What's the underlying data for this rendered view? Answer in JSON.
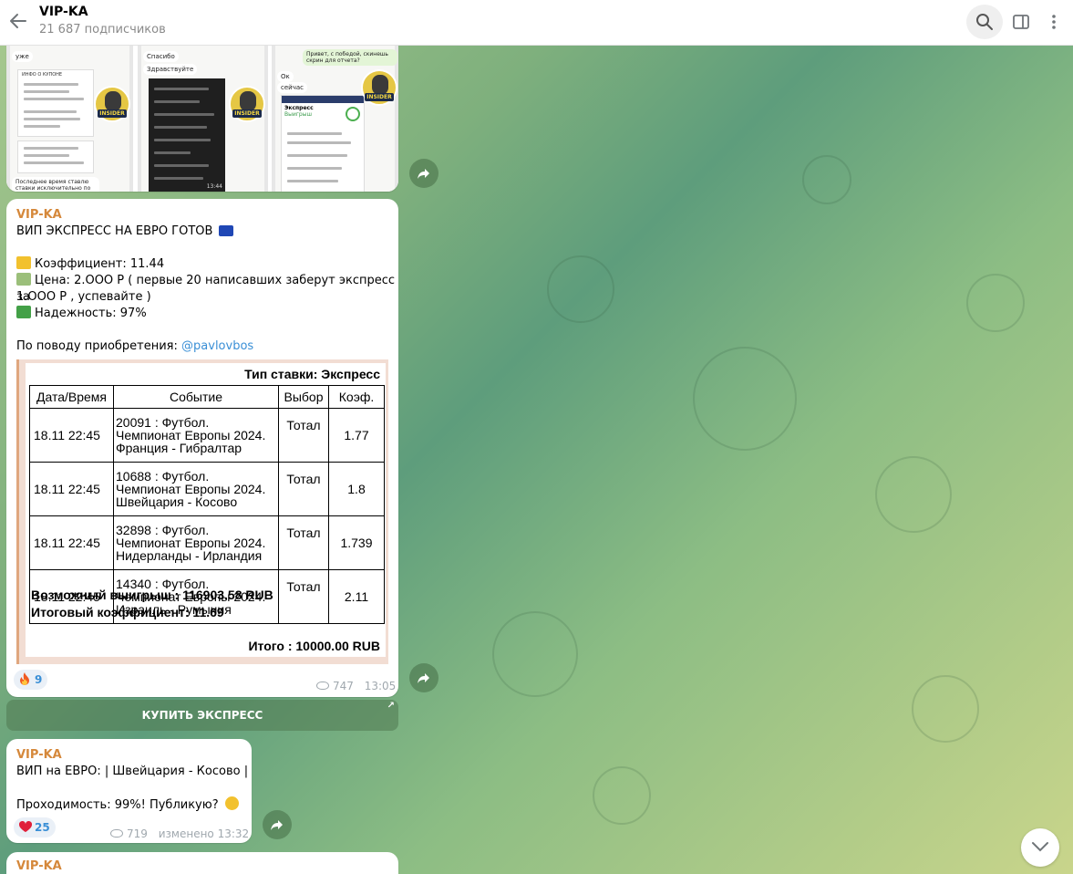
{
  "header": {
    "title": "VIP-KA",
    "subtitle": "21 687 подписчиков"
  },
  "album": {
    "shot1": {
      "top_text": "уже",
      "caption": "Последнее время ставлю ставки исключительно по вашим",
      "panel_title": "ИНФО О КУПОНЕ"
    },
    "shot2": {
      "line1": "Спасибо",
      "line2": "Здравствуйте",
      "time": "13:44"
    },
    "shot3": {
      "line1": "Привет, с победой, скинешь скрин для отчета?",
      "line2": "Ок",
      "line3": "сейчас",
      "panel_title": "Экспресс",
      "panel_sub": "Выигрыш"
    },
    "avatar_badge": "INSIDER"
  },
  "message1": {
    "sender": "VIP-KA",
    "line1": "ВИП ЭКСПРЕСС НА ЕВРО ГОТОВ",
    "line2": "Коэффициент: 11.44",
    "line3": "Цена: 2.ООО Р ( первые 20 написавших заберут экспресс за",
    "line4": "1.ООО Р , успевайте )",
    "line5": "Надежность: 97%",
    "line6_prefix": "По поводу приобретения: ",
    "line6_link": "@pavlovbos",
    "slip": {
      "type": "Тип ставки: Экспресс",
      "headers": [
        "Дата/Время",
        "Событие",
        "Выбор",
        "Коэф."
      ],
      "rows": [
        {
          "date": "18.11 22:45",
          "event1": "20091 : Футбол.",
          "event2": "Чемпионат Европы 2024.",
          "event3": "Франция - Гибралтар",
          "choice": "Тотал",
          "coef": "1.77"
        },
        {
          "date": "18.11 22:45",
          "event1": "10688 : Футбол.",
          "event2": "Чемпионат Европы 2024.",
          "event3": "Швейцария - Косово",
          "choice": "Тотал",
          "coef": "1.8"
        },
        {
          "date": "18.11 22:45",
          "event1": "32898 : Футбол.",
          "event2": "Чемпионат Европы 2024.",
          "event3": "Нидерланды - Ирландия",
          "choice": "Тотал",
          "coef": "1.739"
        },
        {
          "date": "18.11 22:45",
          "event1": "14340 : Футбол.",
          "event2": "Чемпионат Европы 2024.",
          "event3": "Израиль - Румыния",
          "choice": "Тотал",
          "coef": "2.11"
        }
      ],
      "possible_win": "Возможный выигрыш : 116903.58 RUB",
      "total_coef": "Итоговый коэффициент: 11.69",
      "total": "Итого : 10000.00 RUB"
    },
    "reaction_count": "9",
    "views": "747",
    "time": "13:05"
  },
  "buy_button": "КУПИТЬ ЭКСПРЕСС",
  "message2": {
    "sender": "VIP-KA",
    "line1": "ВИП на ЕВРО: | Швейцария - Косово |",
    "line2": "Проходимость: 99%! Публикую?",
    "reaction_count": "25",
    "views": "719",
    "edited_time": "изменено 13:32"
  },
  "message3": {
    "sender": "VIP-KA"
  },
  "colors": {
    "sender": "#d5883b",
    "link": "#3a8fd6"
  }
}
